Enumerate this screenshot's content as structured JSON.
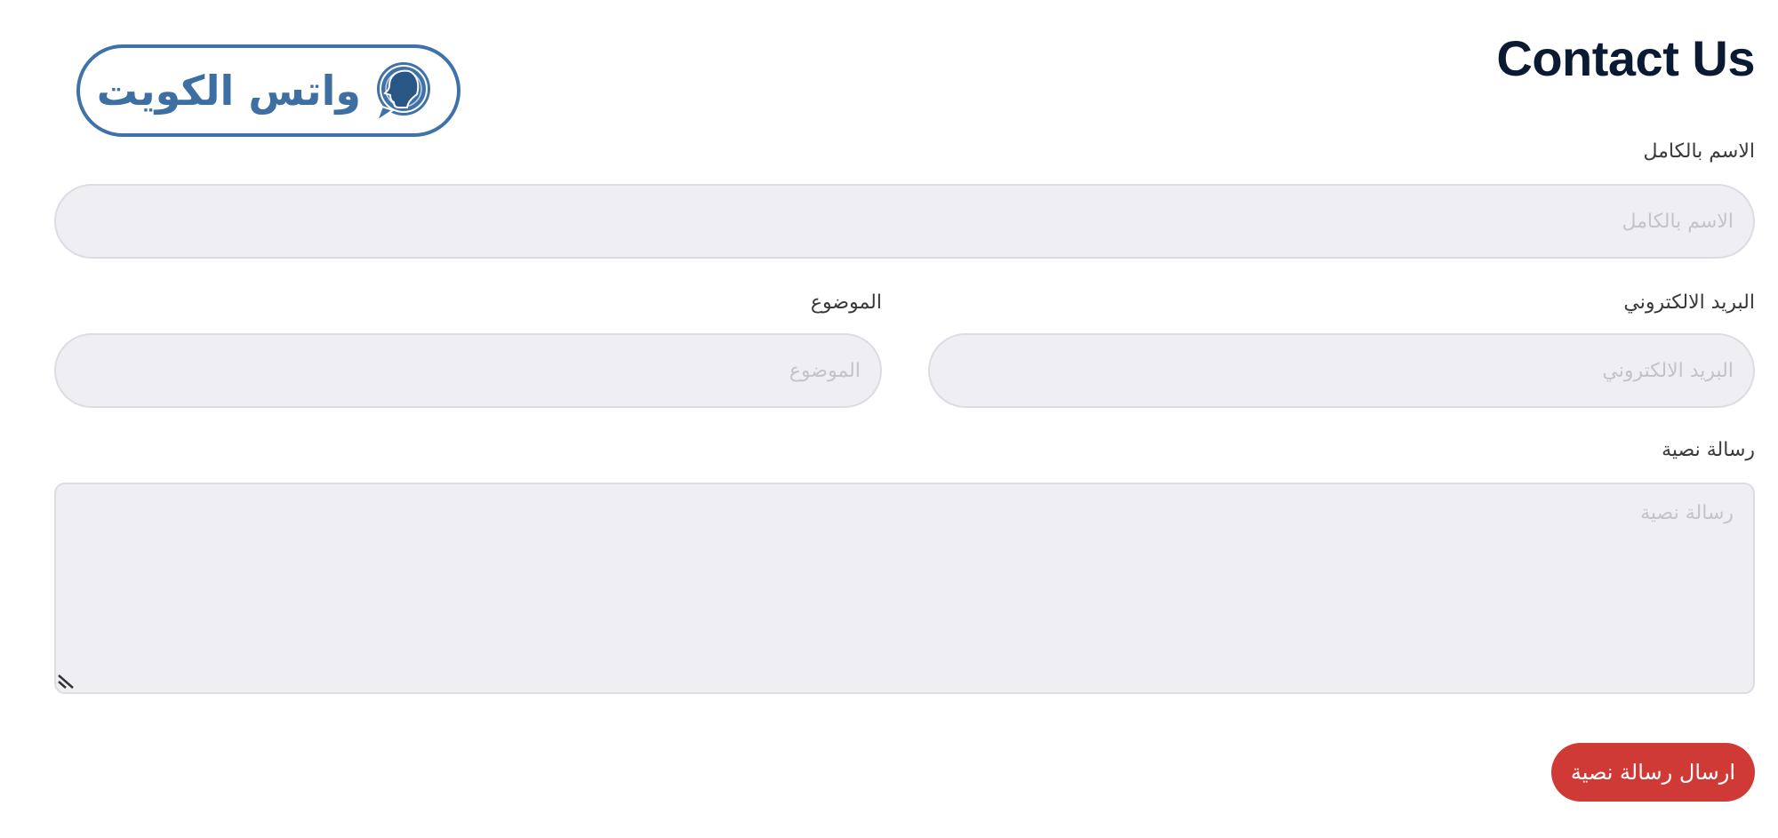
{
  "header": {
    "title": "Contact Us"
  },
  "logo": {
    "text": "واتس الكويت",
    "icon": "head-profile-chat-bubble-icon",
    "color": "#3f72a8"
  },
  "form": {
    "full_name": {
      "label": "الاسم بالكامل",
      "placeholder": "الاسم بالكامل",
      "value": ""
    },
    "email": {
      "label": "البريد الالكتروني",
      "placeholder": "البريد الالكتروني",
      "value": ""
    },
    "subject": {
      "label": "الموضوع",
      "placeholder": "الموضوع",
      "value": ""
    },
    "message": {
      "label": "رسالة نصية",
      "placeholder": "رسالة نصية",
      "value": ""
    },
    "submit_label": "ارسال رسالة نصية"
  },
  "colors": {
    "title": "#0b1a33",
    "input_background": "#efeef3",
    "input_border": "#dcdce2",
    "button": "#cf3a36",
    "button_text": "#ffffff"
  }
}
